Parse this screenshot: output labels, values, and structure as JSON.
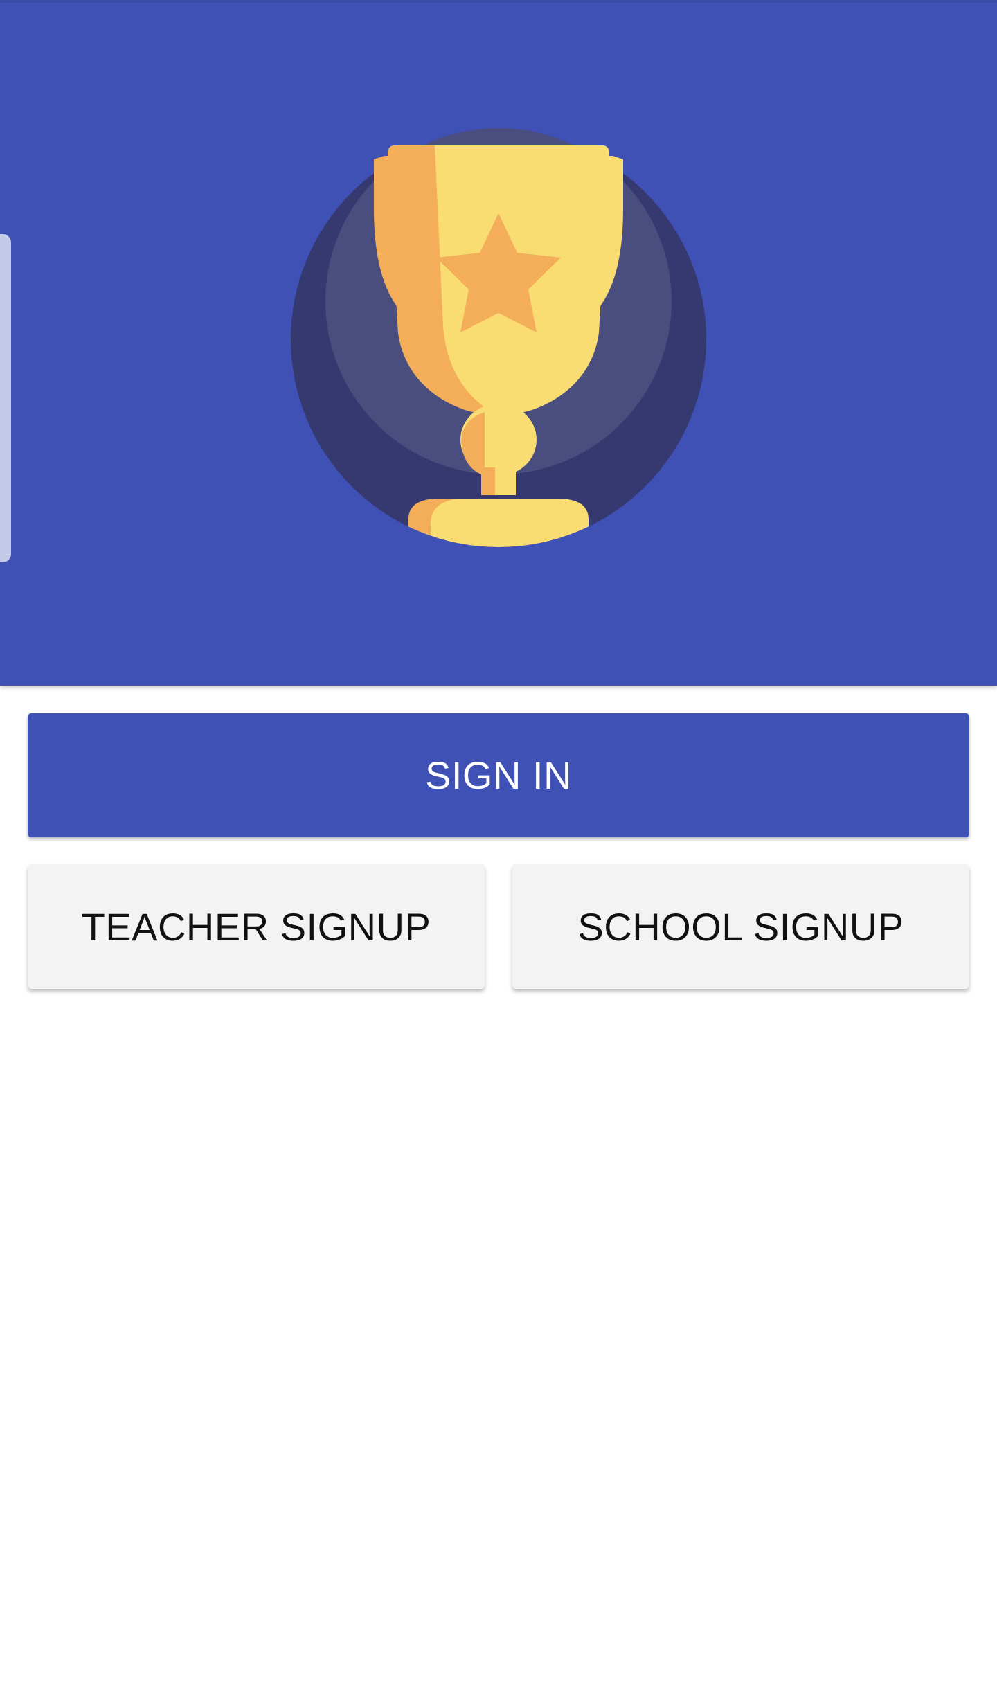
{
  "hero": {
    "background_color": "#3f51b5",
    "illustration": "trophy-icon",
    "trophy_colors": {
      "gold": "#f9dd73",
      "orange": "#f4ae5a",
      "circle_outer": "#35396f",
      "circle_inner": "#4a4e7f"
    }
  },
  "actions": {
    "sign_in_label": "SIGN IN",
    "teacher_signup_label": "TEACHER SIGNUP",
    "school_signup_label": "SCHOOL SIGNUP"
  }
}
